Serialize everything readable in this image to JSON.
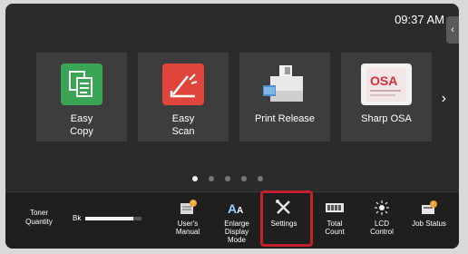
{
  "status": {
    "time": "09:37 AM"
  },
  "apps": [
    {
      "label": "Easy\nCopy",
      "icon": "copy-icon"
    },
    {
      "label": "Easy\nScan",
      "icon": "scan-icon"
    },
    {
      "label": "Print Release",
      "icon": "printer-icon"
    },
    {
      "label": "Sharp OSA",
      "icon": "osa-icon"
    }
  ],
  "pager": {
    "pages": 5,
    "current": 1
  },
  "toner": {
    "label": "Toner\nQuantity",
    "color": "Bk",
    "level": 0.85
  },
  "bottom_items": [
    {
      "label": "User's\nManual",
      "icon": "manual-icon"
    },
    {
      "label": "Enlarge\nDisplay\nMode",
      "icon": "enlarge-icon"
    },
    {
      "label": "Settings",
      "icon": "settings-icon"
    },
    {
      "label": "Total\nCount",
      "icon": "counter-icon"
    },
    {
      "label": "LCD\nControl",
      "icon": "brightness-icon"
    },
    {
      "label": "Job Status",
      "icon": "job-status-icon"
    }
  ],
  "colors": {
    "copy": "#3aa655",
    "scan": "#e0453b",
    "accent": "#c41f2a"
  }
}
